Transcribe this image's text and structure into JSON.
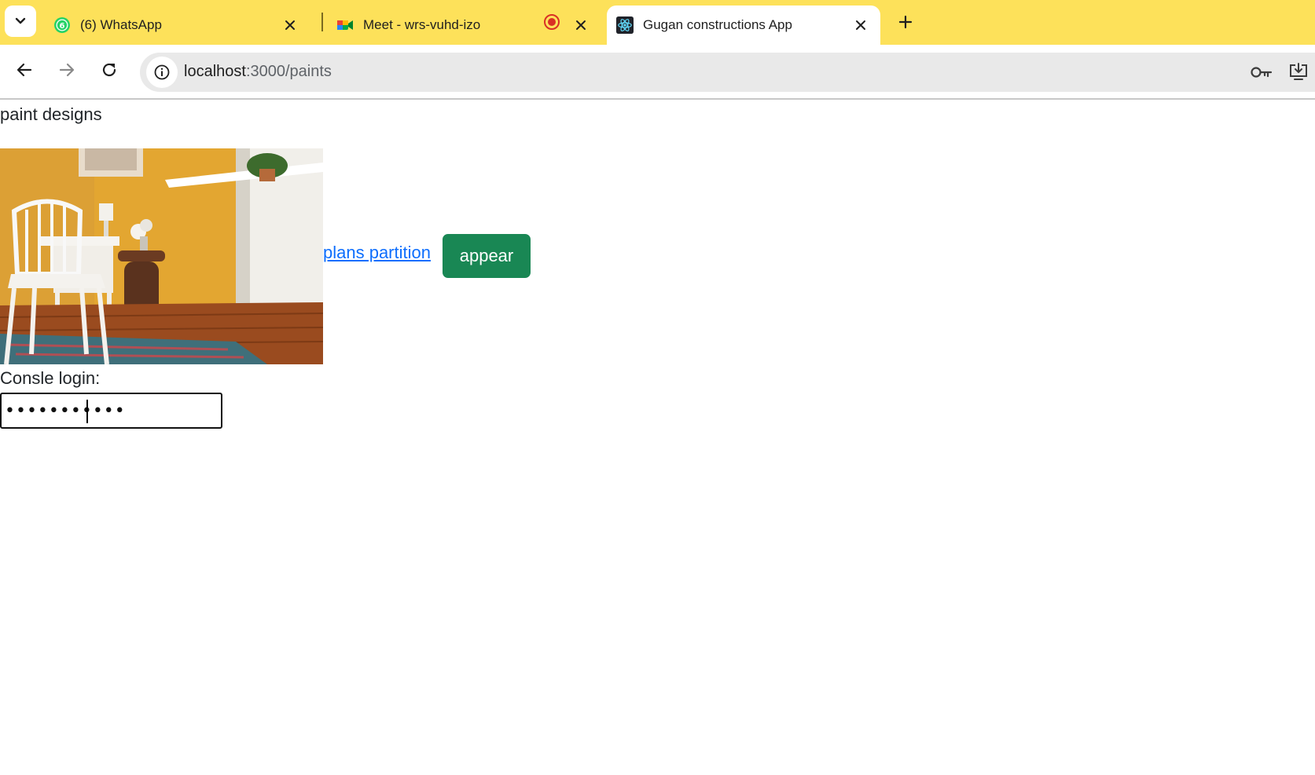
{
  "browser": {
    "tabs": [
      {
        "title": "(6) WhatsApp",
        "badge": "6"
      },
      {
        "title": "Meet - wrs-vuhd-izo"
      },
      {
        "title": "Gugan constructions App",
        "active": true
      }
    ],
    "address": {
      "host": "localhost",
      "path": ":3000/paints"
    }
  },
  "page": {
    "heading": "paint designs",
    "link_label": "plans partition",
    "button_label": "appear",
    "login_label": "Consle login:",
    "password_value": "•••••••••••"
  },
  "colors": {
    "tabstrip": "#fde15a",
    "button_bg": "#198754",
    "link": "#0d6efd"
  },
  "icons": [
    "chevron-down-icon",
    "whatsapp-icon",
    "close-icon",
    "google-meet-icon",
    "recording-icon",
    "react-icon",
    "plus-icon",
    "back-arrow-icon",
    "forward-arrow-icon",
    "reload-icon",
    "site-info-icon",
    "password-key-icon",
    "install-app-icon"
  ]
}
